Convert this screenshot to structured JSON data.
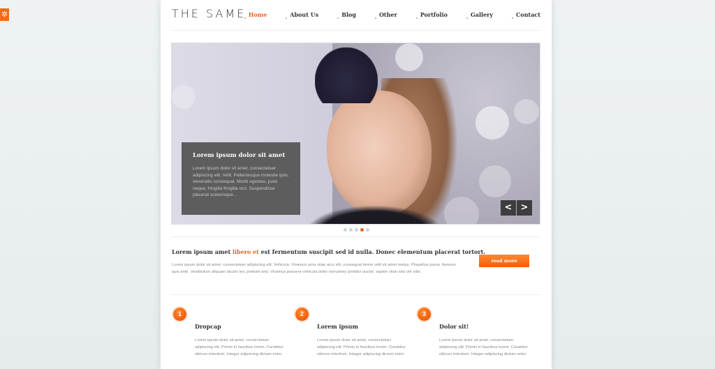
{
  "side_tab": {
    "icon": "gear-icon"
  },
  "header": {
    "logo": "THE SAME",
    "nav": [
      {
        "label": "Home",
        "active": true
      },
      {
        "label": "About Us",
        "active": false
      },
      {
        "label": "Blog",
        "active": false
      },
      {
        "label": "Other",
        "active": false
      },
      {
        "label": "Portfolio",
        "active": false
      },
      {
        "label": "Gallery",
        "active": false
      },
      {
        "label": "Contact",
        "active": false
      }
    ]
  },
  "slider": {
    "caption_title": "Lorem ipsum dolor sit amet",
    "caption_text": "Lorem ipsum dolor sit amet, consectetuer adipiscing elit. Velit. Pellentesque molestie quis, venenatis consequat. Morbi egestas, justo neque, fringilla fringilla orci. Suspendisse placerat scelerisque...",
    "prev_label": "<",
    "next_label": ">",
    "dots": 5,
    "active_dot": 4
  },
  "intro": {
    "title_before": "Lorem ipsum amet ",
    "title_highlight": "libero et",
    "title_after": " est fermentum suscipit sed id nulla. Donec elementum placerat tortort.",
    "text": "Lorem ipsum dolor sit amet, consectetuer adipiscing elit. Vehicula. Vivamus urna vitae arcu elit, consequat lorem velit sit amet metus. Phasellus purus. Aenean quis ante. Vestibulum aliquam iaculis leo, pretium wisi. Vivamus posuere vehicula dolor nonummy porttitor auctor, sapien vitae wisi vel odio.",
    "read_more": "read more"
  },
  "features": [
    {
      "num": "1",
      "title": "Dropcap",
      "text": "Lorem ipsum dolor sit amet, consectetuer adipiscing elit. Primis in faucibus lorem. Curabitur ultrices interdum. Integer adipiscing dictum enim."
    },
    {
      "num": "2",
      "title": "Lorem ipsum",
      "text": "Lorem ipsum dolor sit amet, consectetuer adipiscing elit. Primis in faucibus lorem. Curabitur ultrices interdum. Integer adipiscing dictum enim."
    },
    {
      "num": "3",
      "title": "Dolor sit!",
      "text": "Lorem ipsum dolor sit amet, consectetuer adipiscing elit. Primis in faucibus lorem. Curabitur ultrices interdum. Integer adipiscing dictum enim."
    }
  ],
  "colors": {
    "accent": "#e8641b",
    "caption_bg": "#525252"
  }
}
